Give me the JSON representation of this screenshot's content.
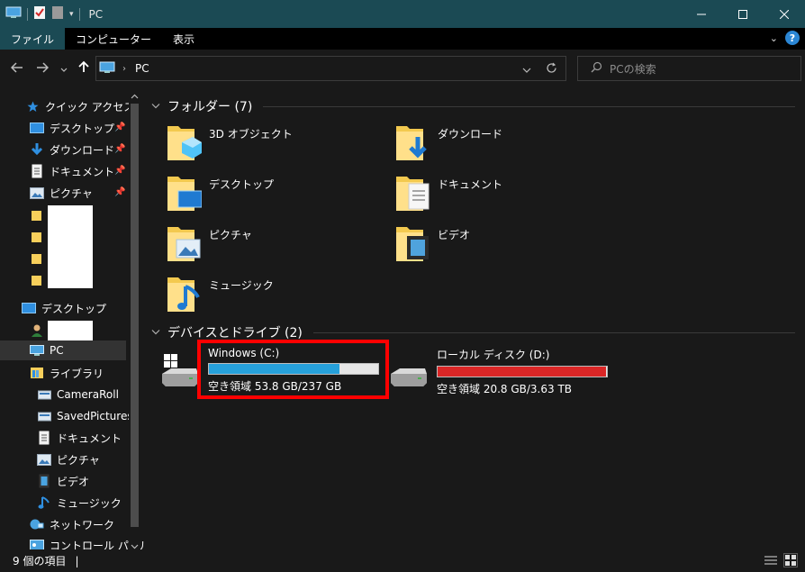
{
  "window": {
    "title": "PC",
    "minimize_label": "—",
    "maximize_label": "☐",
    "close_label": "✕"
  },
  "ribbon": {
    "tabs": [
      {
        "label": "ファイル",
        "active": true
      },
      {
        "label": "コンピューター",
        "active": false
      },
      {
        "label": "表示",
        "active": false
      }
    ],
    "help_label": "?"
  },
  "address": {
    "path": "PC",
    "search_placeholder": "PCの検索"
  },
  "sidebar": {
    "quick_access": "クイック アクセス",
    "pinned": [
      {
        "label": "デスクトップ",
        "icon": "desktop-icon"
      },
      {
        "label": "ダウンロード",
        "icon": "download-icon"
      },
      {
        "label": "ドキュメント",
        "icon": "document-icon"
      },
      {
        "label": "ピクチャ",
        "icon": "picture-icon"
      }
    ],
    "desktop": "デスクトップ",
    "pc": "PC",
    "library": "ライブラリ",
    "library_items": [
      {
        "label": "CameraRoll",
        "icon": "library-icon"
      },
      {
        "label": "SavedPictures",
        "icon": "library-icon"
      },
      {
        "label": "ドキュメント",
        "icon": "document-icon"
      },
      {
        "label": "ピクチャ",
        "icon": "picture-icon"
      },
      {
        "label": "ビデオ",
        "icon": "video-icon"
      },
      {
        "label": "ミュージック",
        "icon": "music-icon"
      }
    ],
    "network": "ネットワーク",
    "control_panel": "コントロール パネル"
  },
  "main": {
    "folders_title": "フォルダー (7)",
    "folders": [
      {
        "label": "3D オブジェクト",
        "icon": "3d-objects-icon"
      },
      {
        "label": "ダウンロード",
        "icon": "downloads-folder-icon"
      },
      {
        "label": "デスクトップ",
        "icon": "desktop-folder-icon"
      },
      {
        "label": "ドキュメント",
        "icon": "documents-folder-icon"
      },
      {
        "label": "ピクチャ",
        "icon": "pictures-folder-icon"
      },
      {
        "label": "ビデオ",
        "icon": "videos-folder-icon"
      },
      {
        "label": "ミュージック",
        "icon": "music-folder-icon"
      }
    ],
    "drives_title": "デバイスとドライブ (2)",
    "drives": [
      {
        "name": "Windows (C:)",
        "free": "空き領域 53.8 GB/237 GB",
        "used_fraction": 0.773,
        "bar_color": "#26a0da",
        "highlighted": true
      },
      {
        "name": "ローカル ディスク (D:)",
        "free": "空き領域 20.8 GB/3.63 TB",
        "used_fraction": 0.994,
        "bar_color": "#da2626",
        "highlighted": false
      }
    ]
  },
  "status": {
    "item_count": "9 個の項目",
    "separator": "|"
  },
  "colors": {
    "titlebar": "#1b4a54",
    "background": "#191919",
    "accent_blue": "#26a0da",
    "danger_red": "#da2626",
    "highlight_box": "#ff0000"
  }
}
